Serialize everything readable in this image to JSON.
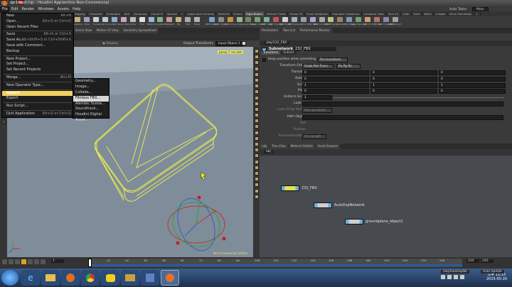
{
  "window": {
    "title": "untitled.hip - Houdini Apprentice Non-Commercial",
    "min": "–",
    "max": "□",
    "close": "×",
    "auto_takes": "Auto Takes",
    "main": "Main"
  },
  "menubar": [
    "File",
    "Edit",
    "Render",
    "Windows",
    "Assets",
    "Help"
  ],
  "file_menu": [
    {
      "label": "New",
      "shortcut": "Alt+N"
    },
    {
      "label": "Open...",
      "shortcut": "Alt+O or Ctrl+O"
    },
    {
      "label": "Open Recent Files",
      "shortcut": ""
    },
    {
      "sep": true
    },
    {
      "label": "Save",
      "shortcut": "Alt+S or Ctrl+S"
    },
    {
      "label": "Save As...",
      "shortcut": "Alt+Shift+S or Ctrl+Shift+S"
    },
    {
      "label": "Save with Comment...",
      "shortcut": ""
    },
    {
      "label": "Backup",
      "shortcut": ""
    },
    {
      "sep": true
    },
    {
      "label": "New Project...",
      "shortcut": ""
    },
    {
      "label": "Set Project...",
      "shortcut": ""
    },
    {
      "label": "Set Recent Projects",
      "shortcut": ""
    },
    {
      "sep": true
    },
    {
      "label": "Merge...",
      "shortcut": "Alt+M"
    },
    {
      "sep": true
    },
    {
      "label": "New Operator Type...",
      "shortcut": ""
    },
    {
      "sep": true
    },
    {
      "label": "Import",
      "shortcut": "",
      "bold": true,
      "hi": true
    },
    {
      "label": "Export",
      "shortcut": ""
    },
    {
      "sep": true
    },
    {
      "label": "Run Script...",
      "shortcut": ""
    },
    {
      "sep": true
    },
    {
      "label": "Quit Application",
      "shortcut": "Alt+Q or Ctrl+Q"
    }
  ],
  "import_submenu": [
    {
      "label": "Geometry..."
    },
    {
      "label": "Image..."
    },
    {
      "label": "Collada..."
    },
    {
      "label": "Filmbox FBX...",
      "hi": true
    },
    {
      "label": "Alembic Scene..."
    },
    {
      "label": "Soundtrack..."
    },
    {
      "label": "Houdini Digital Asset..."
    }
  ],
  "shelf_tabs": [
    "Rigging",
    "Character",
    "Animation",
    "Hair",
    "Grooming",
    "Cloud FX",
    "Volume",
    "+",
    "Lights and Cameras",
    "Particles",
    "Grains",
    "Rigid Bodies",
    "Particle Fluids",
    "Ocean FX",
    "Fluid Containers",
    "Populate Containers",
    "Container Tools",
    "Pyro FX",
    "Cloth",
    "Solid",
    "Wires",
    "Crowds",
    "Drive Simulation",
    "+"
  ],
  "shelf_tools_left": [
    {
      "label": "Skeleton",
      "color": "#c9b37a"
    },
    {
      "label": "Pose",
      "color": "#9aa4b8"
    },
    {
      "label": "Curve",
      "color": "#d0d0d0"
    },
    {
      "label": "Draw Curve",
      "color": "#b8c8d8"
    },
    {
      "label": "Path",
      "color": "#8fb0d0"
    },
    {
      "label": "Spray Paint",
      "color": "#c7a4c9"
    },
    {
      "label": "Circle",
      "color": "#bcbcbc"
    },
    {
      "label": "Font",
      "color": "#e0e0e0"
    },
    {
      "label": "Platonic",
      "color": "#9ab6d8"
    },
    {
      "label": "L-System",
      "color": "#88b088"
    },
    {
      "label": "Metaball",
      "color": "#c89898"
    },
    {
      "label": "File",
      "color": "#c8b080"
    },
    {
      "label": "Null",
      "color": "#aaaaaa"
    },
    {
      "label": "Rivet",
      "color": "#b0b0b0"
    }
  ],
  "shelf_tools_right": [
    {
      "label": "RBD Object",
      "color": "#7aa2d4"
    },
    {
      "label": "Static Object",
      "color": "#8c8c8c"
    },
    {
      "label": "Deforming",
      "color": "#c89040"
    },
    {
      "label": "Glue",
      "color": "#98b890"
    },
    {
      "label": "Ground Plane",
      "color": "#6c8c5c"
    },
    {
      "label": "Terrain Object",
      "color": "#7c9c7c"
    },
    {
      "label": "RBD Glue",
      "color": "#7ab0a0"
    },
    {
      "label": "RBD Fracture",
      "color": "#c05858"
    },
    {
      "label": "RBD Bullet",
      "color": "#d0d0d0"
    },
    {
      "label": "RBD Packed",
      "color": "#a0b0c0"
    },
    {
      "label": "Wind",
      "color": "#90a0b0"
    },
    {
      "label": "RBD Point",
      "color": "#b0a0d0"
    },
    {
      "label": "RBD Cone Twist",
      "color": "#a8a8a8"
    },
    {
      "label": "RBD Projects",
      "color": "#c0c080"
    },
    {
      "label": "Debris",
      "color": "#a08060"
    },
    {
      "label": "RBD Hinge",
      "color": "#8098b0"
    },
    {
      "label": "Glue Adjacent",
      "color": "#70a070"
    },
    {
      "label": "RBD Pin",
      "color": "#c8a070"
    },
    {
      "label": "RBD Car",
      "color": "#b07070"
    },
    {
      "label": "RBD Constraint",
      "color": "#9080b0"
    },
    {
      "label": "RBD Cone T",
      "color": "#a0a0a0"
    }
  ],
  "vp_tabs": [
    "Scene View",
    "Motion FX View",
    "Geometry Spreadsheet"
  ],
  "vp_header": {
    "display": "Display",
    "output_transforms": "Output Transforms",
    "input": "Input Object 1",
    "persp": "persp",
    "cam": "no cam"
  },
  "viewport_watermark": "Non-Commercial Edition",
  "param_tabs": [
    "Parameters",
    "Take List",
    "Performance Monitor"
  ],
  "param_path": "/obj/232_FBX",
  "param": {
    "header": "Subnetwork",
    "name": "232_FBX",
    "tabs": [
      "Transform",
      "Subnet"
    ],
    "keep_pos": "Keep position when parenting",
    "keep_pos_val": "Pre-transform",
    "xform_order_label": "Transform Order",
    "xform_order": "Scale Rot Trans",
    "rot_order": "Rx Ry Rz",
    "rows": [
      {
        "label": "Translate",
        "v": [
          "0",
          "0",
          "0"
        ]
      },
      {
        "label": "Rotate",
        "v": [
          "0",
          "0",
          "0"
        ]
      },
      {
        "label": "Scale",
        "v": [
          "1",
          "1",
          "1"
        ]
      },
      {
        "label": "Pivot",
        "v": [
          "0",
          "0",
          "0"
        ]
      }
    ],
    "uniform_scale": "Uniform Scale",
    "uniform_scale_val": "1",
    "look_at": "Look At",
    "look_at_up": "Look At Up Vector",
    "look_at_up_val": "Use up vector",
    "path_object": "Path Object",
    "roll": "Roll",
    "position": "Position",
    "param_label": "Parameterization",
    "param_val": "Arc Length"
  },
  "net_tabs": [
    "/obj",
    "Tree View",
    "Material Palette",
    "Asset Browser"
  ],
  "net_path": "obj",
  "nodes": [
    {
      "label": "232_FBX"
    },
    {
      "label": "AutoDopNetwork"
    },
    {
      "label": "groundplane_object1"
    }
  ],
  "timeline": {
    "frame": "1",
    "start": "1",
    "end": "240",
    "fps_end": "240",
    "marks": [
      "12",
      "24",
      "36",
      "48",
      "60",
      "72",
      "84",
      "96",
      "108",
      "120",
      "132",
      "144",
      "156",
      "168",
      "180",
      "192",
      "204",
      "216",
      "228"
    ],
    "path": "/obj/AutoDopNe",
    "auto_update": "Auto Update"
  },
  "taskbar": {
    "time": "오후 11:15",
    "date": "2015-05-20"
  }
}
